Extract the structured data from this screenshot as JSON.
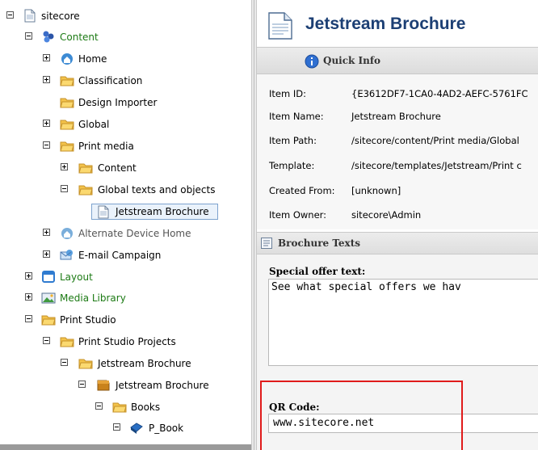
{
  "tree": {
    "items": [
      {
        "label": "sitecore",
        "toggle": "minus",
        "icon": "page-icon",
        "color": "black"
      },
      {
        "label": "Content",
        "toggle": "minus",
        "icon": "content-icon",
        "color": "green"
      },
      {
        "label": "Home",
        "toggle": "plus",
        "icon": "home-icon",
        "color": "black"
      },
      {
        "label": "Classification",
        "toggle": "plus",
        "icon": "folder-icon",
        "color": "black"
      },
      {
        "label": "Design Importer",
        "toggle": "none",
        "icon": "folder-icon",
        "color": "black"
      },
      {
        "label": "Global",
        "toggle": "plus",
        "icon": "folder-icon",
        "color": "black"
      },
      {
        "label": "Print media",
        "toggle": "minus",
        "icon": "folder-icon",
        "color": "black"
      },
      {
        "label": "Content",
        "toggle": "plus",
        "icon": "folder-icon",
        "color": "black"
      },
      {
        "label": "Global texts and objects",
        "toggle": "minus",
        "icon": "folder-icon",
        "color": "black"
      },
      {
        "label": "Jetstream Brochure",
        "toggle": "none",
        "icon": "page-icon",
        "color": "black",
        "selected": true
      },
      {
        "label": "Alternate Device Home",
        "toggle": "plus",
        "icon": "home-icon",
        "color": "gray"
      },
      {
        "label": "E-mail Campaign",
        "toggle": "plus",
        "icon": "email-campaign-icon",
        "color": "black"
      },
      {
        "label": "Layout",
        "toggle": "plus",
        "icon": "layout-icon",
        "color": "green"
      },
      {
        "label": "Media Library",
        "toggle": "plus",
        "icon": "media-icon",
        "color": "green"
      },
      {
        "label": "Print Studio",
        "toggle": "minus",
        "icon": "folder-icon",
        "color": "black"
      },
      {
        "label": "Print Studio Projects",
        "toggle": "minus",
        "icon": "folder-icon",
        "color": "black"
      },
      {
        "label": "Jetstream Brochure",
        "toggle": "minus",
        "icon": "folder-icon",
        "color": "black"
      },
      {
        "label": "Jetstream Brochure",
        "toggle": "minus",
        "icon": "project-icon",
        "color": "black"
      },
      {
        "label": "Books",
        "toggle": "minus",
        "icon": "folder-icon",
        "color": "black"
      },
      {
        "label": "P_Book",
        "toggle": "minus",
        "icon": "book-icon",
        "color": "black"
      }
    ]
  },
  "editor": {
    "title": "Jetstream Brochure",
    "quick_info": {
      "label": "Quick Info",
      "rows": [
        {
          "key": "Item ID:",
          "value": "{E3612DF7-1CA0-4AD2-AEFC-5761FC"
        },
        {
          "key": "Item Name:",
          "value": "Jetstream Brochure"
        },
        {
          "key": "Item Path:",
          "value": "/sitecore/content/Print media/Global"
        },
        {
          "key": "Template:",
          "value": "/sitecore/templates/Jetstream/Print c"
        },
        {
          "key": "Created From:",
          "value": "[unknown]"
        },
        {
          "key": "Item Owner:",
          "value": "sitecore\\Admin"
        }
      ]
    },
    "section": {
      "label": "Brochure Texts"
    },
    "fields": {
      "special_offer": {
        "label": "Special offer text:",
        "value": "See what special offers we hav"
      },
      "qr_code": {
        "label": "QR Code:",
        "value": "www.sitecore.net"
      }
    }
  },
  "colors": {
    "title": "#1c3f74",
    "tree_green": "#1c7a14",
    "highlight": "#e01b1b",
    "selection_border": "#7da2ce"
  }
}
